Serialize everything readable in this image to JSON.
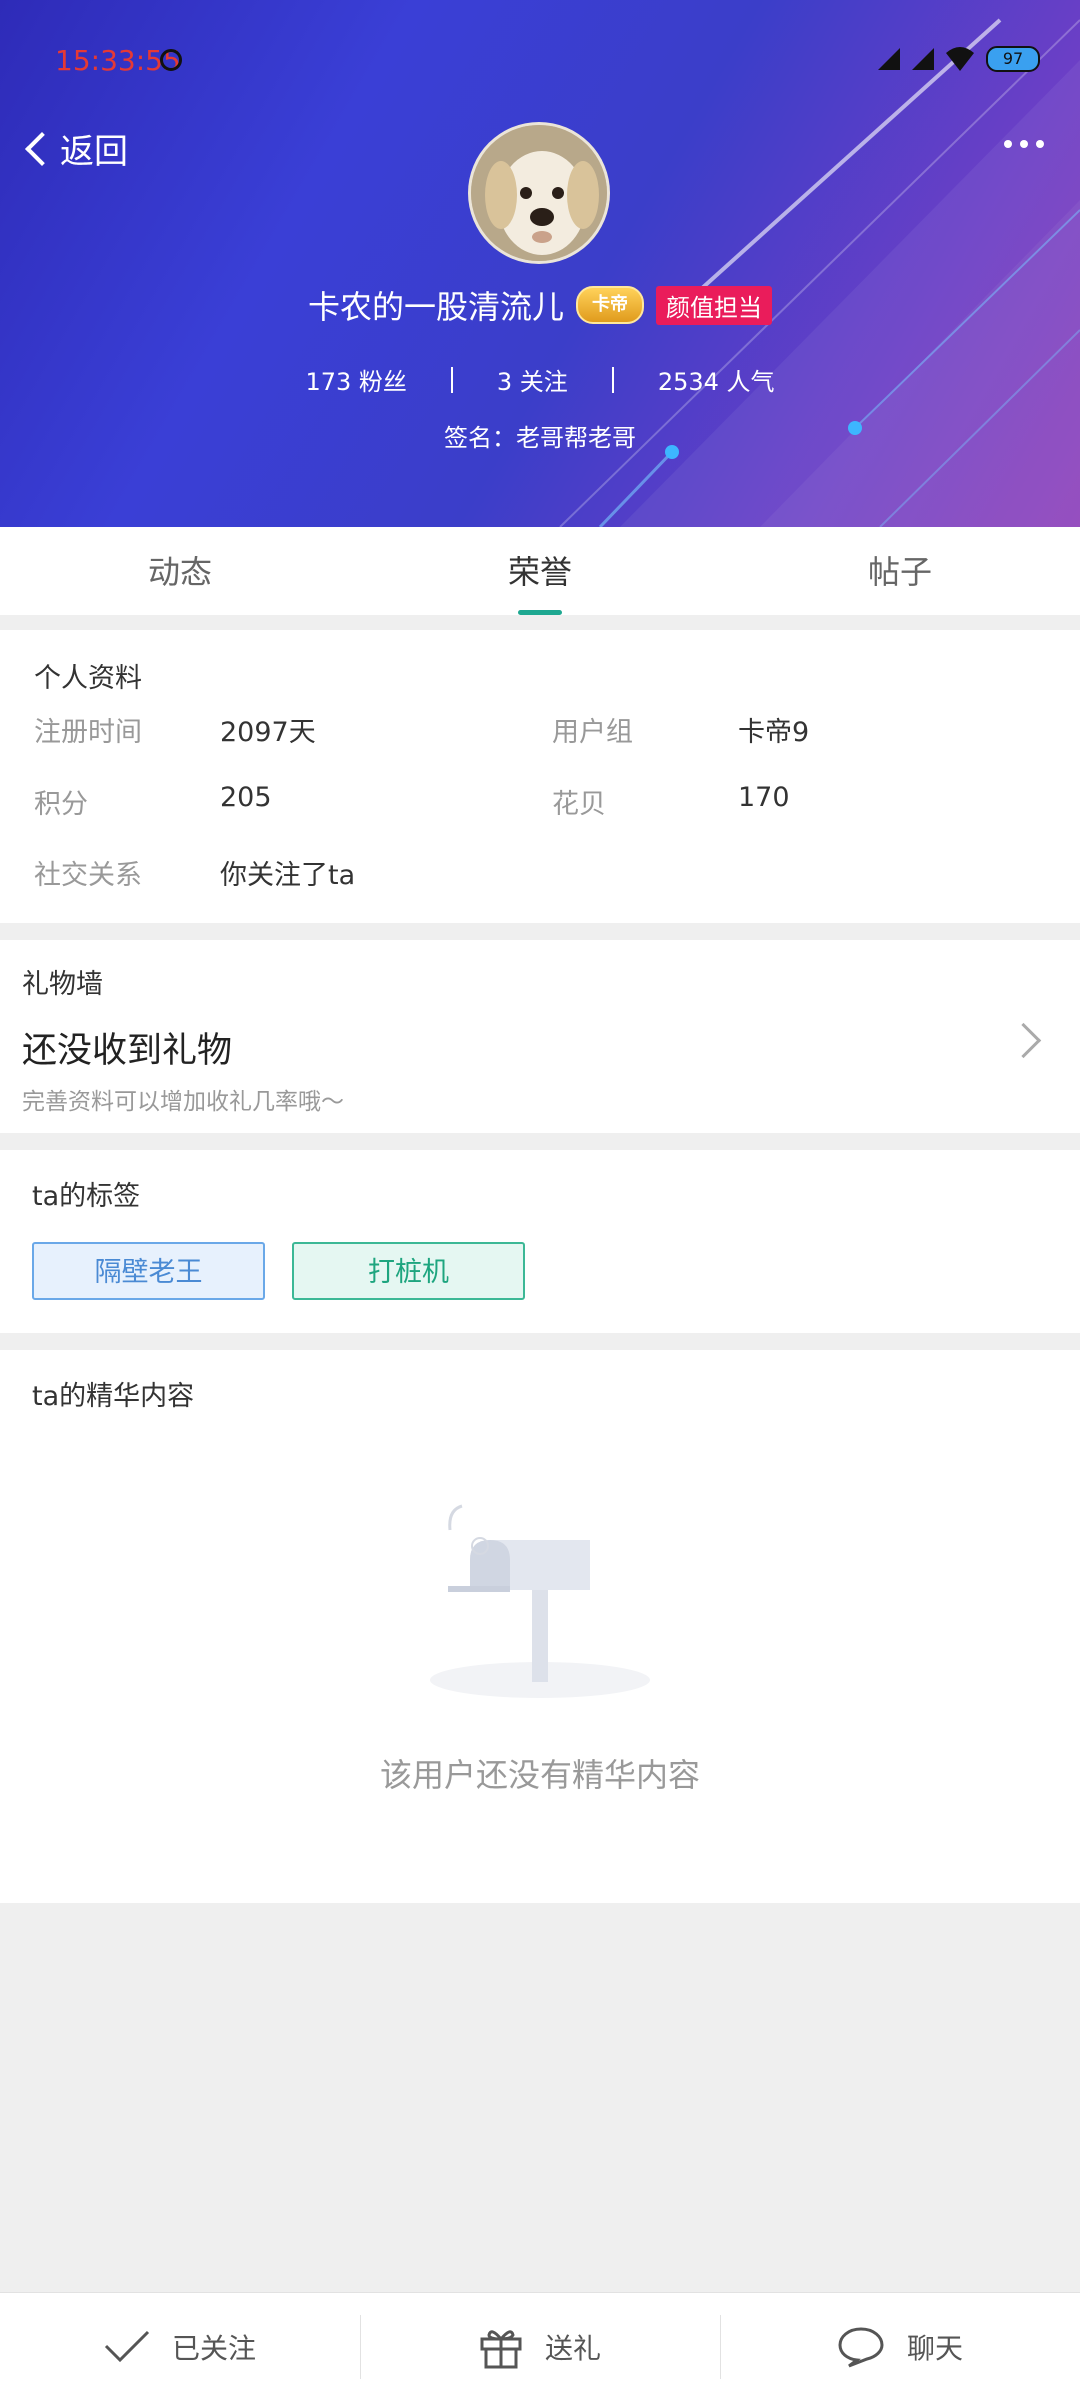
{
  "status_bar": {
    "time": "15:33:55",
    "battery": "97"
  },
  "header": {
    "back_label": "返回",
    "username": "卡农的一股清流儿",
    "rank_badge": "卡帝",
    "title_badge": "颜值担当",
    "stats": {
      "fans": "173 粉丝",
      "following": "3 关注",
      "popularity": "2534 人气"
    },
    "signature": "签名：老哥帮老哥"
  },
  "tabs": [
    {
      "label": "动态",
      "active": false
    },
    {
      "label": "荣誉",
      "active": true
    },
    {
      "label": "帖子",
      "active": false
    }
  ],
  "profile": {
    "title": "个人资料",
    "fields": {
      "register_time": {
        "label": "注册时间",
        "value": "2097天"
      },
      "user_group": {
        "label": "用户组",
        "value": "卡帝9"
      },
      "points": {
        "label": "积分",
        "value": "205"
      },
      "huabei": {
        "label": "花贝",
        "value": "170"
      },
      "social": {
        "label": "社交关系",
        "value": "你关注了ta"
      }
    }
  },
  "gifts": {
    "title": "礼物墙",
    "empty_text": "还没收到礼物",
    "hint": "完善资料可以增加收礼几率哦～"
  },
  "tags": {
    "title": "ta的标签",
    "items": [
      "隔壁老王",
      "打桩机"
    ]
  },
  "essence": {
    "title": "ta的精华内容",
    "empty_text": "该用户还没有精华内容"
  },
  "bottom_bar": {
    "follow": "已关注",
    "gift": "送礼",
    "chat": "聊天"
  },
  "colors": {
    "accent": "#1ea891",
    "title_badge": "#ea1c5b",
    "header_start": "#2e2bb8",
    "header_end": "#8b3bb8"
  }
}
